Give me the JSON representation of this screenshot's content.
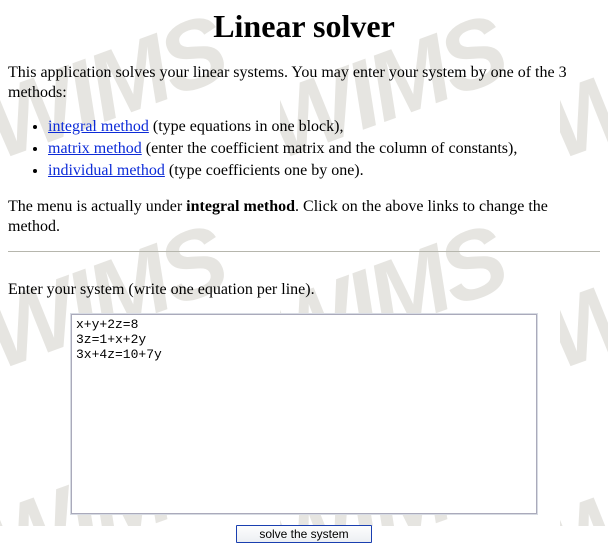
{
  "title": "Linear solver",
  "intro": "This application solves your linear systems. You may enter your system by one of the 3 methods:",
  "methods": {
    "items": [
      {
        "link": "integral method",
        "desc": " (type equations in one block),"
      },
      {
        "link": "matrix method",
        "desc": " (enter the coefficient matrix and the column of constants),"
      },
      {
        "link": "individual method",
        "desc": " (type coefficients one by one)."
      }
    ]
  },
  "current_line": {
    "pre": "The menu is actually under ",
    "method": "integral method",
    "post": ". Click on the above links to change the method."
  },
  "system": {
    "label": "Enter your system (write one equation per line).",
    "value": "x+y+2z=8\n3z=1+x+2y\n3x+4z=10+7y"
  },
  "buttons": {
    "solve": "solve the system"
  }
}
